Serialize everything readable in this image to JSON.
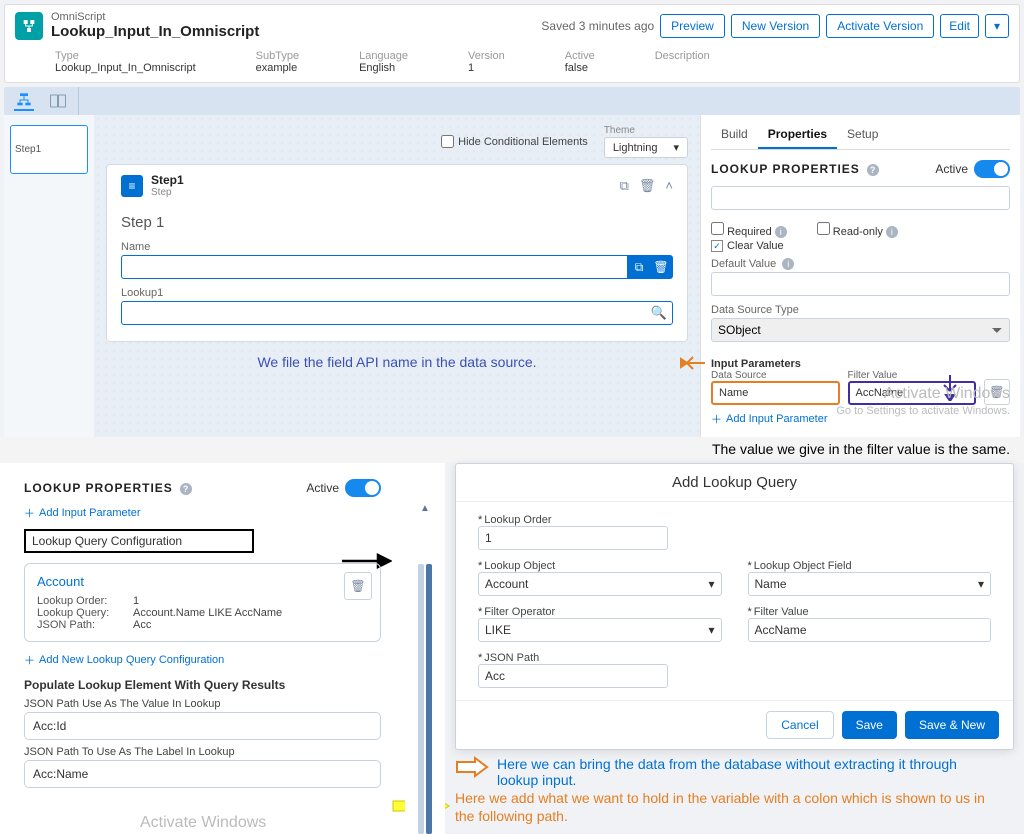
{
  "header": {
    "breadcrumb": "OmniScript",
    "title": "Lookup_Input_In_Omniscript",
    "saved": "Saved 3 minutes ago",
    "buttons": {
      "preview": "Preview",
      "newver": "New Version",
      "activate": "Activate Version",
      "edit": "Edit"
    },
    "meta": {
      "type_l": "Type",
      "type_v": "Lookup_Input_In_Omniscript",
      "subtype_l": "SubType",
      "subtype_v": "example",
      "lang_l": "Language",
      "lang_v": "English",
      "ver_l": "Version",
      "ver_v": "1",
      "active_l": "Active",
      "active_v": "false",
      "desc_l": "Description",
      "desc_v": ""
    }
  },
  "canvas": {
    "hide_cond": "Hide Conditional Elements",
    "theme_l": "Theme",
    "theme_v": "Lightning",
    "step_chip": "Step1",
    "step_name": "Step1",
    "step_type": "Step",
    "step_body_title": "Step 1",
    "name_label": "Name",
    "lookup_label": "Lookup1",
    "caption": "We file the field API name in the data source."
  },
  "props": {
    "tabs": {
      "build": "Build",
      "properties": "Properties",
      "setup": "Setup"
    },
    "section_title": "LOOKUP PROPERTIES",
    "active_l": "Active",
    "required": "Required",
    "readonly": "Read-only",
    "clearval": "Clear Value",
    "default_l": "Default Value",
    "dstype_l": "Data Source Type",
    "dstype_v": "SObject",
    "inparams": "Input Parameters",
    "ds_l": "Data Source",
    "ds_v": "Name",
    "fv_l": "Filter Value",
    "fv_v": "AccName",
    "addparam": "Add Input Parameter",
    "watermark1": "Activate Windows",
    "watermark2": "Go to Settings to activate Windows.",
    "tail_caption": "The value we give in the filter value is the same."
  },
  "lower": {
    "addparam": "Add Input Parameter",
    "lqc": "Lookup Query Configuration",
    "acct_title": "Account",
    "k1": "Lookup Order:",
    "v1": "1",
    "k2": "Lookup Query:",
    "v2": "Account.Name LIKE AccName",
    "k3": "JSON Path:",
    "v3": "Acc",
    "add_new_lqc": "Add New Lookup Query Configuration",
    "populate": "Populate Lookup Element With Query Results",
    "jp_val_l": "JSON Path Use As The Value In Lookup",
    "jp_val_v": "Acc:Id",
    "jp_lbl_l": "JSON Path To Use As The Label In Lookup",
    "jp_lbl_v": "Acc:Name",
    "watermark": "Activate Windows"
  },
  "modal": {
    "title": "Add Lookup Query",
    "order_l": "Lookup Order",
    "order_v": "1",
    "obj_l": "Lookup Object",
    "obj_v": "Account",
    "objf_l": "Lookup Object Field",
    "objf_v": "Name",
    "fo_l": "Filter Operator",
    "fo_v": "LIKE",
    "fv_l": "Filter Value",
    "fv_v": "AccName",
    "jp_l": "JSON Path",
    "jp_v": "Acc",
    "cancel": "Cancel",
    "save": "Save",
    "savenew": "Save & New"
  },
  "anno": {
    "orange1": "Here we can bring the data from the database without extracting it through",
    "orange2": "lookup input.",
    "yellow1": "Here we add what we want to hold in the variable with a colon which is shown to us in",
    "yellow2": "the following path."
  }
}
